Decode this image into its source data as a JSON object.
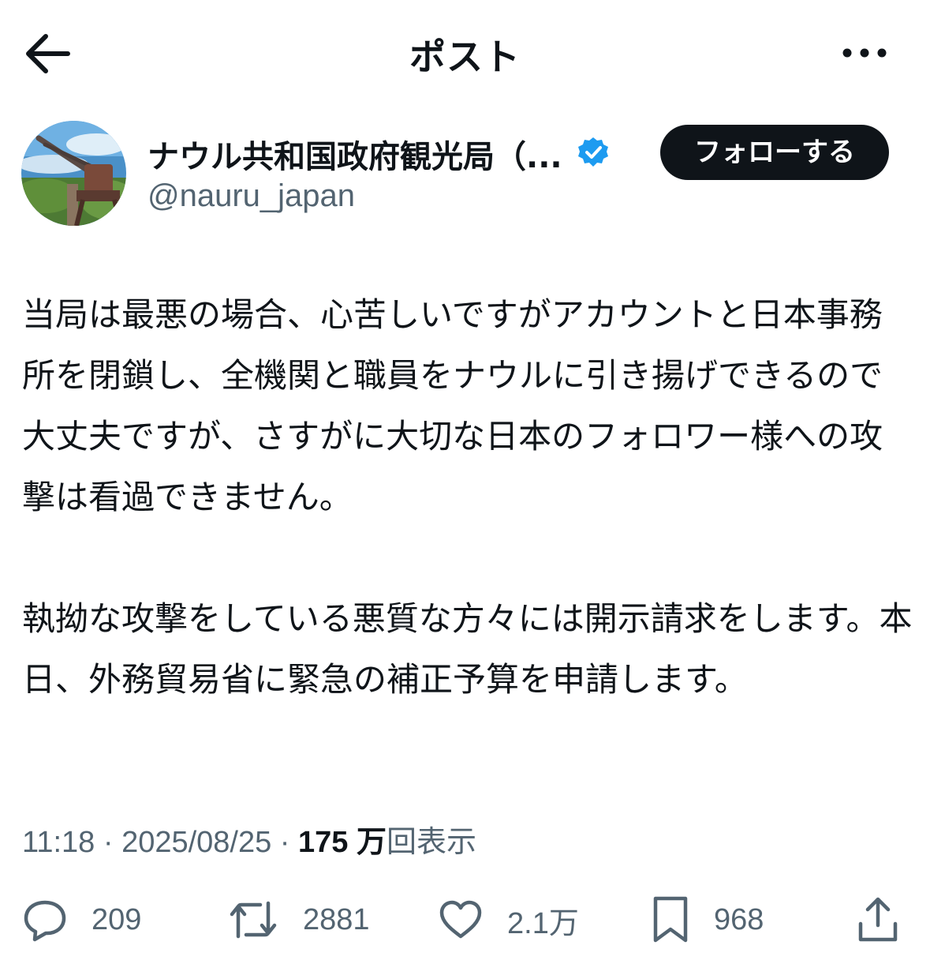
{
  "header": {
    "title": "ポスト"
  },
  "author": {
    "name": "ナウル共和国政府観光局（...",
    "handle": "@nauru_japan",
    "follow_label": "フォローする",
    "verified_color": "#1d9bf0"
  },
  "tweet": {
    "paragraphs": [
      "当局は最悪の場合、心苦しいですがアカウントと日本事務所を閉鎖し、全機関と職員をナウルに引き揚げできるので大丈夫ですが、さすがに大切な日本のフォロワー様への攻撃は看過できません。",
      "執拗な攻撃をしている悪質な方々には開示請求をします。本日、外務貿易省に緊急の補正予算を申請します。"
    ]
  },
  "meta": {
    "time": "11:18",
    "separator": " · ",
    "date": "2025/08/25",
    "views_count": "175 万",
    "views_label": "回表示"
  },
  "actions": {
    "replies": "209",
    "reposts": "2881",
    "likes": "2.1万",
    "bookmarks": "968"
  },
  "icons": [
    "arrow-left-icon",
    "more-icon",
    "verified-icon",
    "reply-icon",
    "repost-icon",
    "like-icon",
    "bookmark-icon",
    "share-icon"
  ],
  "colors": {
    "text": "#0f1419",
    "secondary": "#536471",
    "button_bg": "#0f1419"
  }
}
